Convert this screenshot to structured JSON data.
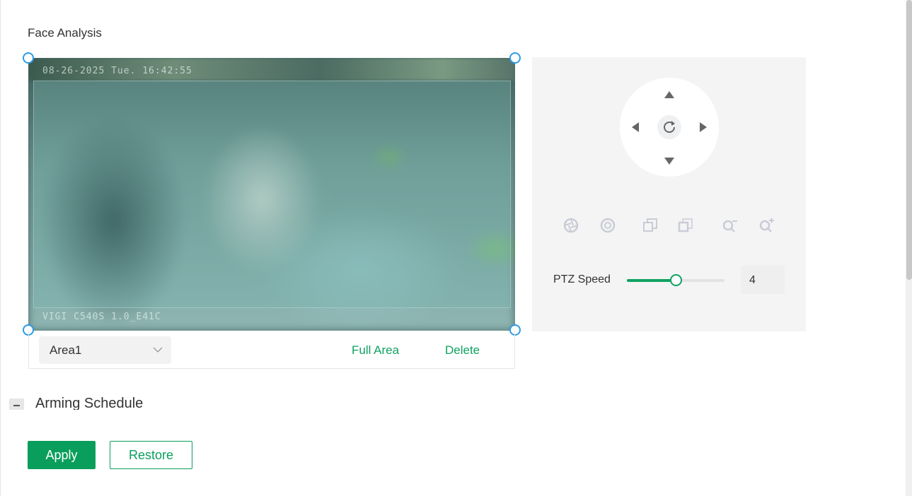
{
  "page": {
    "title": "Face Analysis"
  },
  "video": {
    "osd_date": "08-26-2025 Tue. 16:42:55",
    "osd_model": "VIGI C540S 1.0_E41C"
  },
  "area": {
    "selected": "Area1",
    "full_area_label": "Full Area",
    "delete_label": "Delete"
  },
  "ptz": {
    "icons": {
      "up": "arrow-up-icon",
      "down": "arrow-down-icon",
      "left": "arrow-left-icon",
      "right": "arrow-right-icon",
      "reset": "refresh-icon",
      "tools": [
        "iris-open-icon",
        "iris-close-icon",
        "focus-near-icon",
        "focus-far-icon",
        "zoom-out-icon",
        "zoom-in-icon"
      ]
    },
    "speed_label": "PTZ Speed",
    "speed_value": "4",
    "speed_fraction": 0.5
  },
  "arming": {
    "label": "Arming Schedule"
  },
  "buttons": {
    "apply": "Apply",
    "restore": "Restore"
  },
  "colors": {
    "accent": "#0a9e5c",
    "handle": "#2b9be6"
  }
}
